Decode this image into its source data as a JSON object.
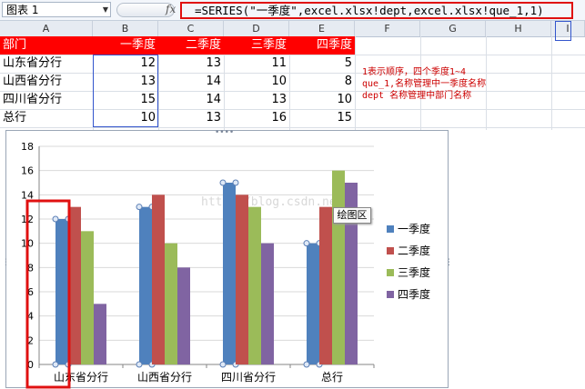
{
  "formula_bar": {
    "name_box": "图表 1",
    "fx_label": "fx",
    "formula": "=SERIES(\"一季度\",excel.xlsx!dept,excel.xlsx!que_1,1)"
  },
  "columns": [
    "A",
    "B",
    "C",
    "D",
    "E",
    "F",
    "G",
    "H",
    "I"
  ],
  "sheet": {
    "header": [
      "部门",
      "一季度",
      "二季度",
      "三季度",
      "四季度"
    ],
    "rows": [
      {
        "dept": "山东省分行",
        "q1": "12",
        "q2": "13",
        "q3": "11",
        "q4": "5"
      },
      {
        "dept": "山西省分行",
        "q1": "13",
        "q2": "14",
        "q3": "10",
        "q4": "8"
      },
      {
        "dept": "四川省分行",
        "q1": "15",
        "q2": "14",
        "q3": "13",
        "q4": "10"
      },
      {
        "dept": "总行",
        "q1": "10",
        "q2": "13",
        "q3": "16",
        "q4": "15"
      }
    ]
  },
  "annotation": {
    "line1": "1表示顺序，四个季度1~4",
    "line2": "que_1,名称管理中一季度名称",
    "line3": "dept 名称管理中部门名称"
  },
  "watermark": "http://blog.csdn.net/",
  "tooltip": "绘图区",
  "colors": {
    "q1": "#4f81bd",
    "q2": "#c0504d",
    "q3": "#9bbb59",
    "q4": "#8064a2",
    "highlight": "#e01010"
  },
  "chart_data": {
    "type": "bar",
    "categories": [
      "山东省分行",
      "山西省分行",
      "四川省分行",
      "总行"
    ],
    "series": [
      {
        "name": "一季度",
        "values": [
          12,
          13,
          15,
          10
        ]
      },
      {
        "name": "二季度",
        "values": [
          13,
          14,
          14,
          13
        ]
      },
      {
        "name": "三季度",
        "values": [
          11,
          10,
          13,
          16
        ]
      },
      {
        "name": "四季度",
        "values": [
          5,
          8,
          10,
          15
        ]
      }
    ],
    "ylim": [
      0,
      18
    ],
    "yticks": [
      "0",
      "2",
      "4",
      "6",
      "8",
      "10",
      "12",
      "14",
      "16",
      "18"
    ],
    "legend": "right",
    "grid": true,
    "selected_series": "一季度"
  }
}
